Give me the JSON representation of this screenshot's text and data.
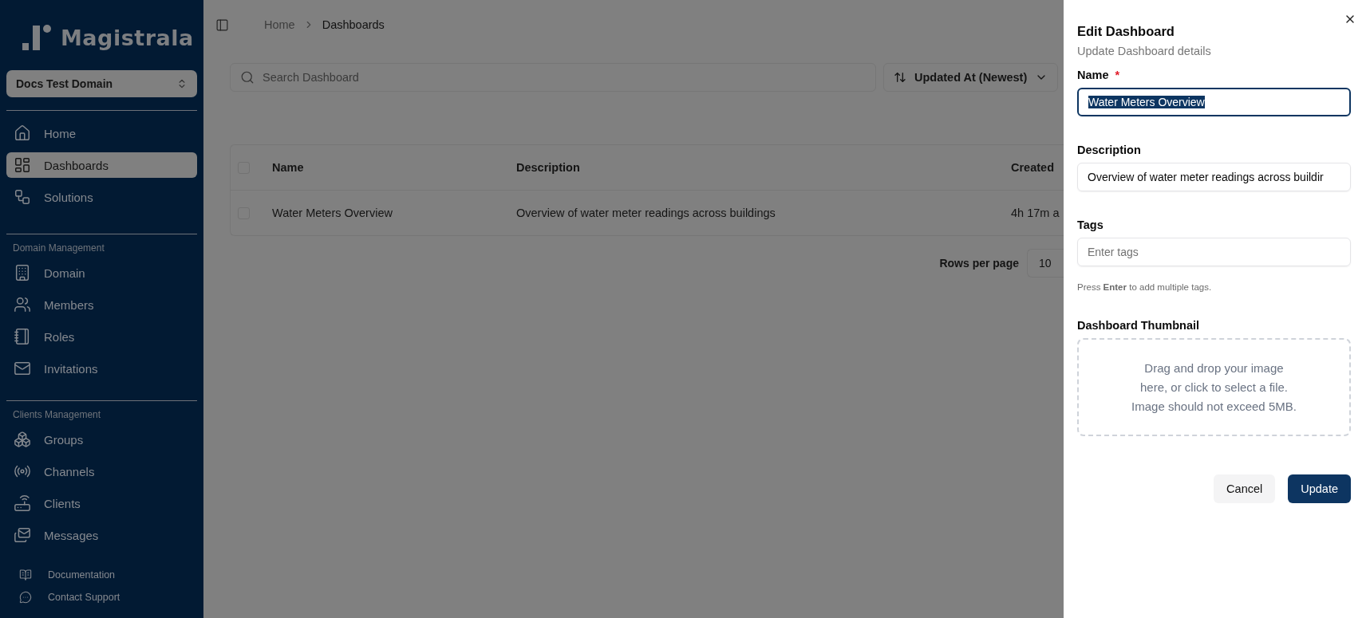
{
  "sidebar": {
    "logo": "Magistrala",
    "domain_selector": "Docs Test Domain",
    "sections": [
      {
        "items": [
          {
            "label": "Home",
            "selected": false
          },
          {
            "label": "Dashboards",
            "selected": true
          },
          {
            "label": "Solutions",
            "selected": false
          }
        ]
      },
      {
        "heading": "Domain Management",
        "items": [
          {
            "label": "Domain",
            "selected": false
          },
          {
            "label": "Members",
            "selected": false
          },
          {
            "label": "Roles",
            "selected": false
          },
          {
            "label": "Invitations",
            "selected": false
          }
        ]
      },
      {
        "heading": "Clients Management",
        "items": [
          {
            "label": "Groups",
            "selected": false
          },
          {
            "label": "Channels",
            "selected": false
          },
          {
            "label": "Clients",
            "selected": false
          },
          {
            "label": "Messages",
            "selected": false
          }
        ]
      }
    ],
    "footer_links": [
      "Documentation",
      "Contact Support"
    ]
  },
  "breadcrumb": [
    "Home",
    "Dashboards"
  ],
  "search": {
    "placeholder": "Search Dashboard"
  },
  "sort_button": "Updated At (Newest)",
  "table": {
    "header_checked": false,
    "columns": [
      "Name",
      "Description",
      "Created"
    ],
    "rows": [
      {
        "checked": false,
        "cells": [
          "Water Meters Overview",
          "Overview of water meter readings across buildings",
          "4h 17m a"
        ]
      }
    ]
  },
  "pagination": {
    "label": "Rows per page",
    "value": "10"
  },
  "drawer": {
    "title": "Edit Dashboard",
    "subtitle": "Update Dashboard details",
    "name": {
      "label": "Name",
      "required_mark": "*",
      "value": "Water Meters Overview",
      "text_selected": true
    },
    "description": {
      "label": "Description",
      "value": "Overview of water meter readings across buildir"
    },
    "tags": {
      "label": "Tags",
      "placeholder": "Enter tags",
      "hint": "Press **Enter** to add multiple tags."
    },
    "thumbnail": {
      "label": "Dashboard Thumbnail",
      "lines": [
        "Drag and drop your image",
        "here, or click to select a file.",
        "Image should not exceed 5MB."
      ]
    },
    "buttons": [
      {
        "label": "Cancel",
        "kind": "secondary"
      },
      {
        "label": "Update",
        "kind": "primary"
      }
    ]
  }
}
